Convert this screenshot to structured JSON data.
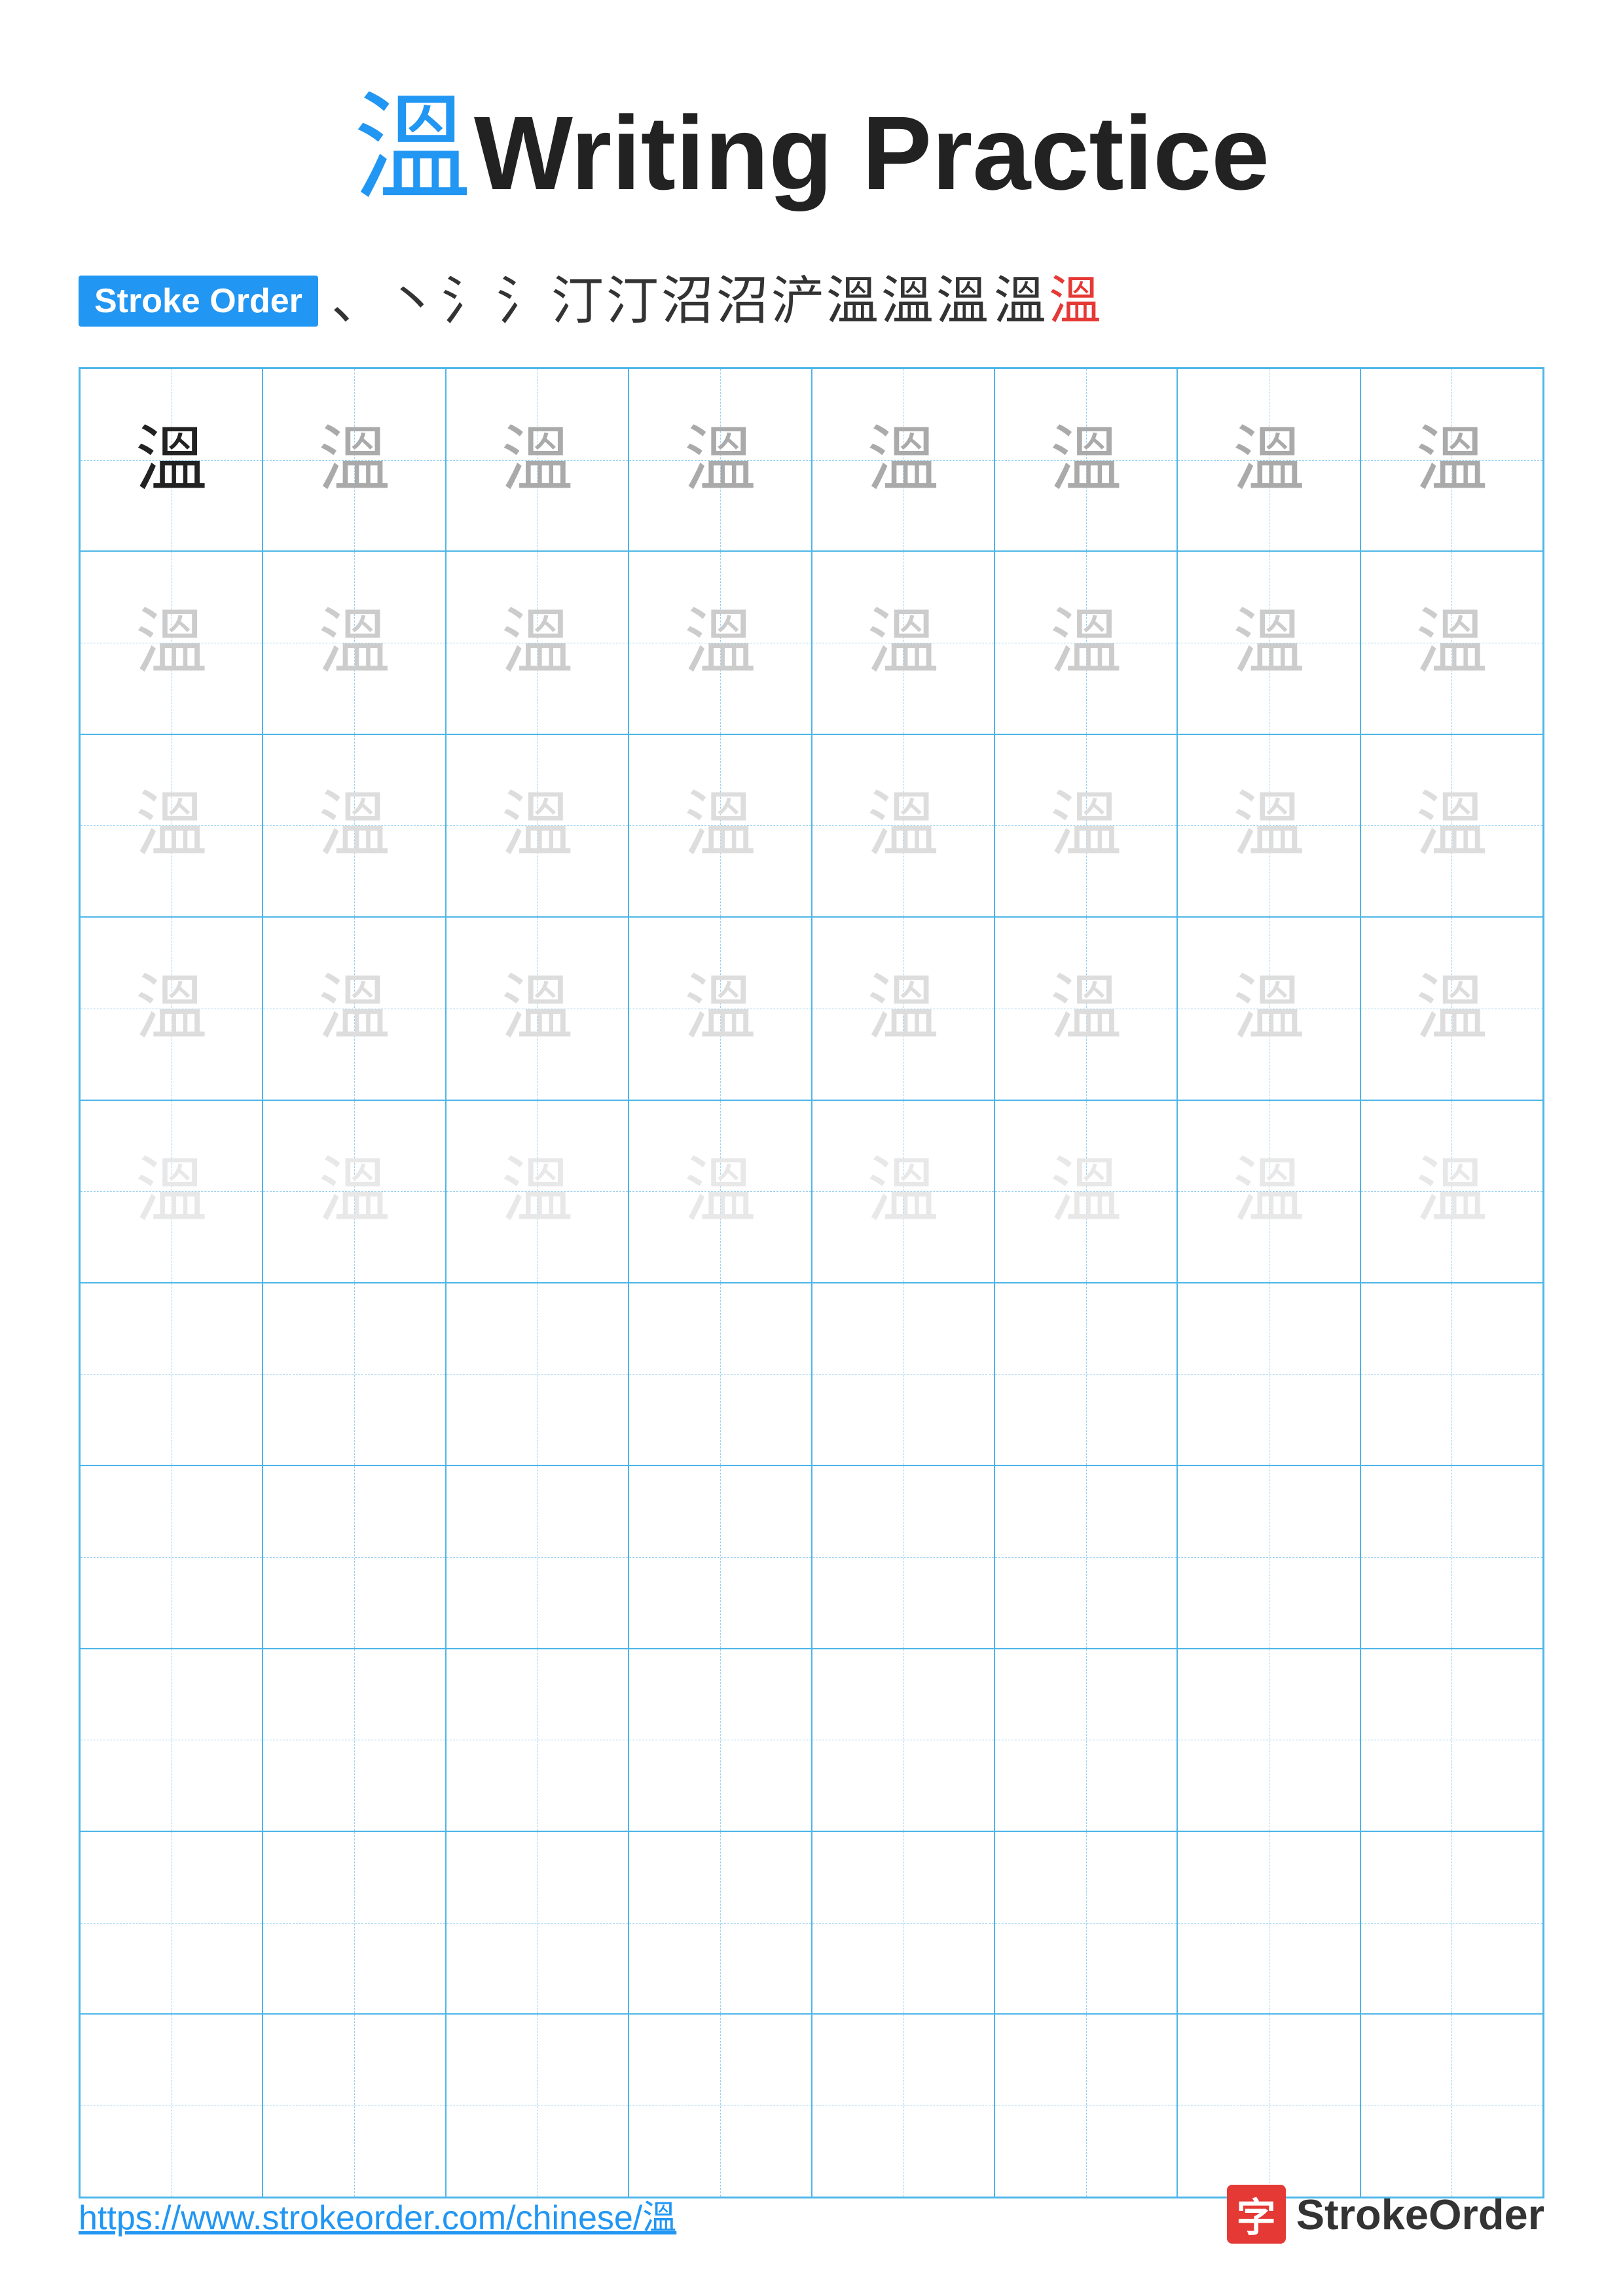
{
  "title": {
    "char": "溫",
    "text": "Writing Practice"
  },
  "stroke_order": {
    "label": "Stroke Order",
    "sequence": [
      "、",
      "、",
      "氵",
      "氵",
      "汀",
      "汀",
      "汀",
      "汀",
      "汀",
      "浐",
      "溫",
      "溫",
      "溫",
      "溫"
    ]
  },
  "grid": {
    "cols": 8,
    "rows": 10,
    "char": "溫",
    "practice_rows": 5,
    "empty_rows": 5
  },
  "footer": {
    "url": "https://www.strokeorder.com/chinese/溫",
    "logo_char": "字",
    "logo_text": "StrokeOrder"
  }
}
